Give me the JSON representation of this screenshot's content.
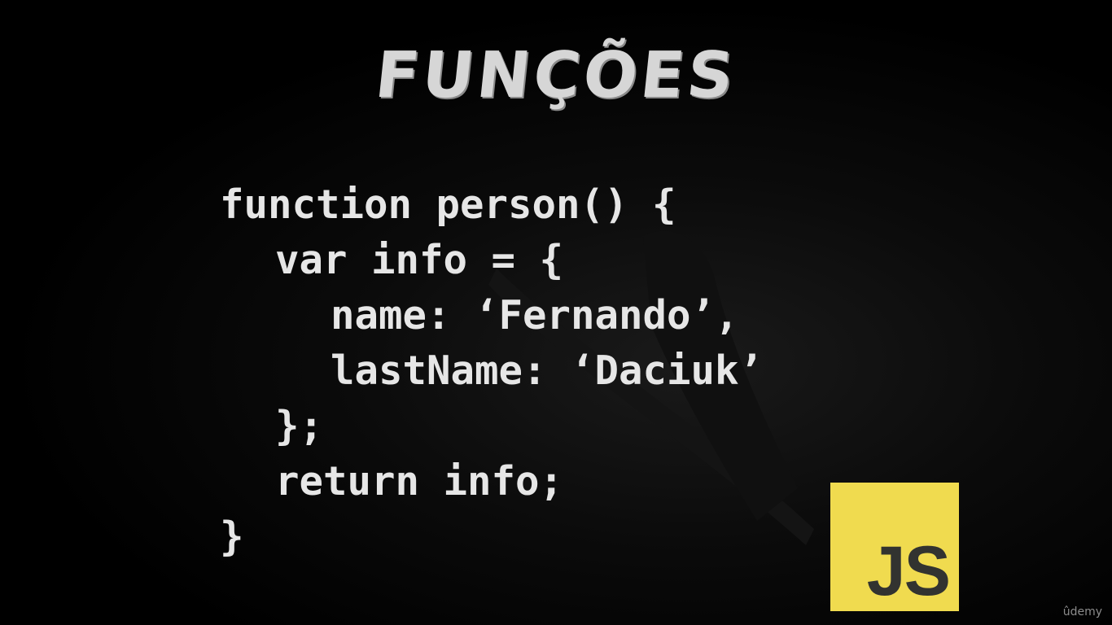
{
  "slide": {
    "title": "FUNÇÕES",
    "code_lines": [
      "function person() {",
      "var info = {",
      "name: ‘Fernando’,",
      "lastName: ‘Daciuk’",
      "};",
      "return info;",
      "}"
    ],
    "logo_text": "JS",
    "watermark": "ûdemy"
  },
  "colors": {
    "background": "#000000",
    "text": "#e6e6e6",
    "title": "#d6d6d6",
    "js_logo_bg": "#f0db4f",
    "js_logo_text": "#323330"
  }
}
